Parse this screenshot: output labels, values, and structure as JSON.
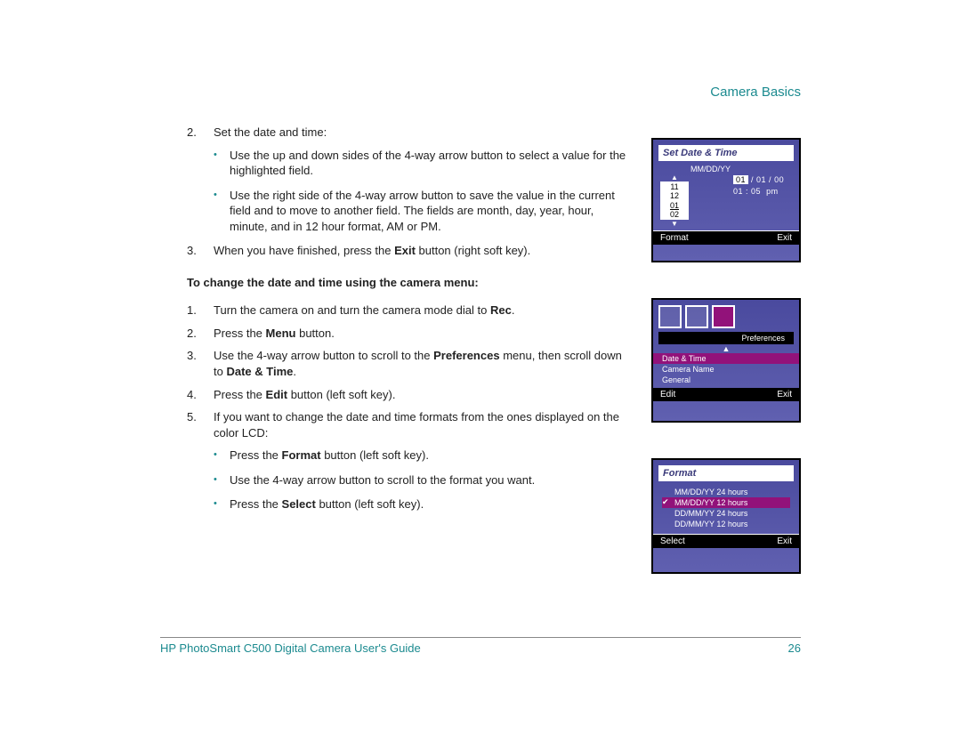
{
  "header": "Camera Basics",
  "steps_a": [
    {
      "n": "2.",
      "text": "Set the date and time:"
    }
  ],
  "bullets_a": [
    "Use the up and down sides of the 4-way arrow button to select a value for the highlighted field.",
    "Use the right side of the 4-way arrow button to save the value in the current field and to move to another field. The fields are month, day, year, hour, minute, and in 12 hour format, AM or PM."
  ],
  "step_a3": {
    "n": "3.",
    "pre": "When you have finished, press the ",
    "bold": "Exit",
    "post": " button (right soft key)."
  },
  "subhead": "To change the date and time using the camera menu:",
  "steps_b": [
    {
      "n": "1.",
      "parts": [
        "Turn the camera on and turn the camera mode dial to ",
        "Rec",
        "."
      ]
    },
    {
      "n": "2.",
      "parts": [
        "Press the ",
        "Menu",
        " button."
      ]
    },
    {
      "n": "3.",
      "parts": [
        "Use the 4-way arrow button to scroll to the ",
        "Preferences",
        " menu, then scroll down to ",
        "Date & Time",
        "."
      ]
    },
    {
      "n": "4.",
      "parts": [
        "Press the ",
        "Edit",
        " button (left soft key)."
      ]
    },
    {
      "n": "5.",
      "plain": "If you want to change the date and time formats from the ones displayed on the color LCD:"
    }
  ],
  "bullets_b": [
    {
      "parts": [
        "Press the ",
        "Format",
        " button (left soft key)."
      ]
    },
    {
      "plain": "Use the 4-way arrow button to scroll to the format you want."
    },
    {
      "parts": [
        "Press the ",
        "Select",
        " button (left soft key)."
      ]
    }
  ],
  "footer_left": "HP PhotoSmart C500 Digital Camera User's Guide",
  "footer_right": "26",
  "shot1": {
    "title": "Set Date & Time",
    "fmt": "MM/DD/YY",
    "wheel": [
      "11",
      "12",
      "01",
      "02"
    ],
    "date": {
      "m": "01",
      "d": "01",
      "y": "00"
    },
    "time": {
      "h": "01",
      "mm": "05",
      "ap": "pm"
    },
    "left": "Format",
    "right": "Exit"
  },
  "shot2": {
    "pref_label": "Preferences",
    "options": [
      "Date & Time",
      "Camera Name",
      "General"
    ],
    "left": "Edit",
    "right": "Exit"
  },
  "shot3": {
    "title": "Format",
    "rows": [
      "MM/DD/YY 24 hours",
      "MM/DD/YY 12 hours",
      "DD/MM/YY 24 hours",
      "DD/MM/YY 12 hours"
    ],
    "left": "Select",
    "right": "Exit"
  }
}
